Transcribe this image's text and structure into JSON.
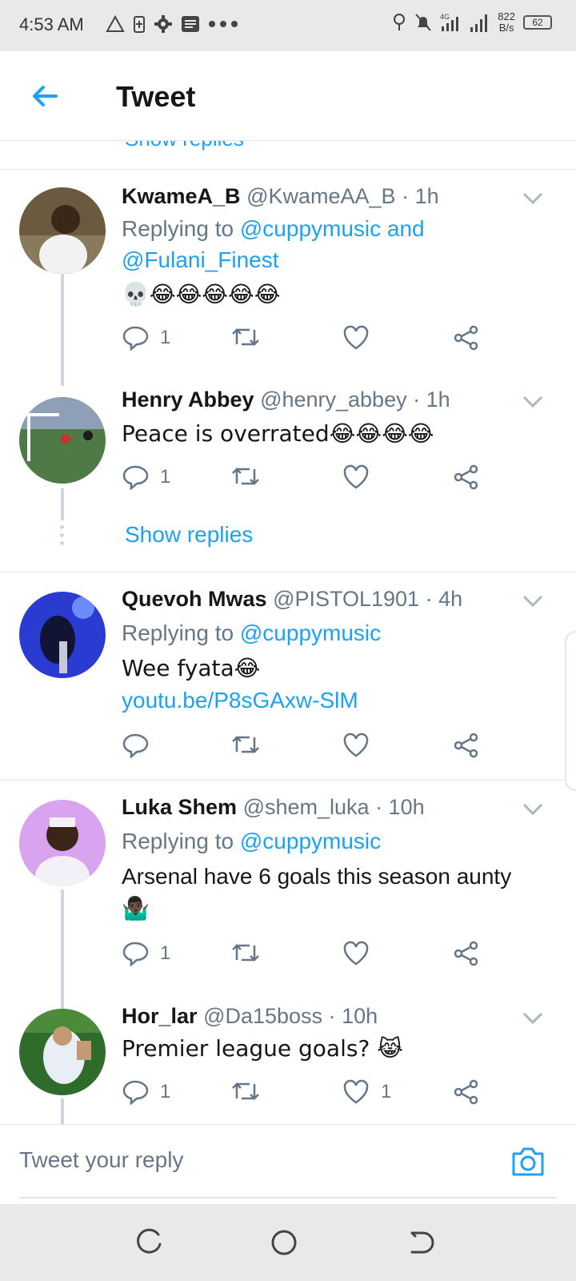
{
  "status_bar": {
    "time": "4:53 AM",
    "network_speed_value": "822",
    "network_speed_unit": "B/s",
    "battery": "62",
    "signal_label": "4G"
  },
  "header": {
    "title": "Tweet"
  },
  "partial_show_replies": "Show replies",
  "tweets": [
    {
      "name": "KwameA_B",
      "handle": "@KwameAA_B",
      "time": "· 1h",
      "replying_label": "Replying to",
      "replying_to": "@cuppymusic and @Fulani_Finest",
      "text": "💀😂😂😂😂😂",
      "reply_count": "1",
      "retweet_count": "",
      "like_count": ""
    },
    {
      "name": "Henry Abbey",
      "handle": "@henry_abbey",
      "time": "· 1h",
      "text": "Peace is overrated😂😂😂😂",
      "reply_count": "1",
      "retweet_count": "",
      "like_count": "",
      "show_replies": "Show replies"
    },
    {
      "name": "Quevoh Mwas",
      "handle": "@PISTOL1901",
      "time": "· 4h",
      "replying_label": "Replying to",
      "replying_to": "@cuppymusic",
      "text": "Wee fyata😂",
      "link": "youtu.be/P8sGAxw-SlM",
      "reply_count": "",
      "retweet_count": "",
      "like_count": ""
    },
    {
      "name": "Luka Shem",
      "handle": "@shem_luka",
      "time": "· 10h",
      "replying_label": "Replying to",
      "replying_to": "@cuppymusic",
      "text": "Arsenal have 6 goals this season aunty",
      "text2": "🤷🏿‍♂️",
      "reply_count": "1",
      "retweet_count": "",
      "like_count": ""
    },
    {
      "name": "Hor_lar",
      "handle": "@Da15boss",
      "time": "· 10h",
      "text": "Premier league goals? 😹",
      "reply_count": "1",
      "retweet_count": "",
      "like_count": "1"
    }
  ],
  "composer": {
    "placeholder": "Tweet your reply"
  },
  "colors": {
    "accent": "#1da1f2",
    "secondary_text": "#657786",
    "divider": "#e1e8ed"
  }
}
